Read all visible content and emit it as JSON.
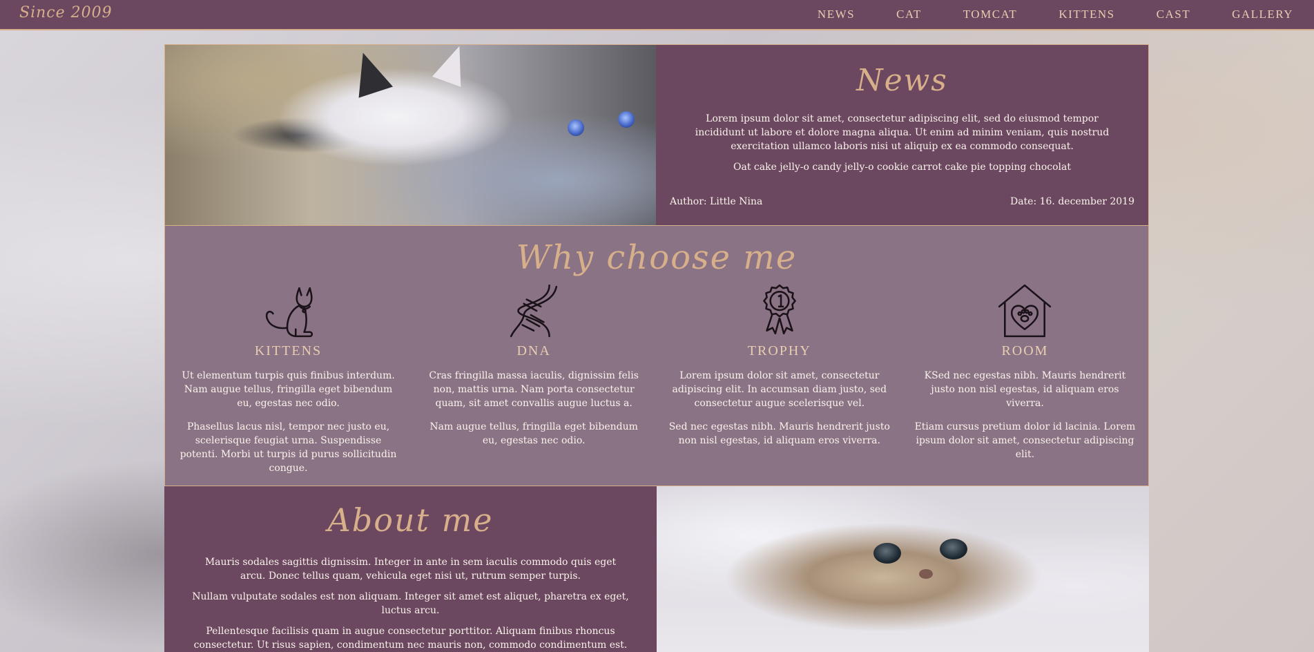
{
  "nav": {
    "brand": "Since 2009",
    "links": [
      "NEWS",
      "CAT",
      "TOMCAT",
      "KITTENS",
      "CAST",
      "GALLERY"
    ]
  },
  "news": {
    "title": "News",
    "text": "Lorem ipsum dolor sit amet, consectetur adipiscing elit, sed do eiusmod tempor incididunt ut labore et dolore magna aliqua. Ut enim ad minim veniam, quis nostrud exercitation ullamco laboris nisi ut aliquip ex ea commodo consequat.",
    "text2": "Oat cake jelly-o candy jelly-o cookie carrot cake pie topping chocolat",
    "author": "Author: Little Nina",
    "date": "Date: 16. december 2019"
  },
  "why": {
    "title": "Why choose me",
    "features": [
      {
        "icon": "cat-icon",
        "name": "KITTENS",
        "p1": "Ut elementum turpis quis finibus interdum. Nam augue tellus, fringilla eget bibendum eu, egestas nec odio.",
        "p2": "Phasellus lacus nisl, tempor nec justo eu, scelerisque feugiat urna. Suspendisse potenti. Morbi ut turpis id purus sollicitudin congue."
      },
      {
        "icon": "dna-icon",
        "name": "DNA",
        "p1": "Cras fringilla massa iaculis, dignissim felis non, mattis urna. Nam porta consectetur quam, sit amet convallis augue luctus a.",
        "p2": "Nam augue tellus, fringilla eget bibendum eu, egestas nec odio."
      },
      {
        "icon": "trophy-medal-icon",
        "name": "TROPHY",
        "p1": "Lorem ipsum dolor sit amet, consectetur adipiscing elit. In accumsan diam justo, sed consectetur augue scelerisque vel.",
        "p2": "Sed nec egestas nibh. Mauris hendrerit justo non nisl egestas, id aliquam eros viverra."
      },
      {
        "icon": "pet-house-icon",
        "name": "ROOM",
        "p1": "KSed nec egestas nibh. Mauris hendrerit justo non nisl egestas, id aliquam eros viverra.",
        "p2": "Etiam cursus pretium dolor id lacinia. Lorem ipsum dolor sit amet, consectetur adipiscing elit."
      }
    ]
  },
  "about": {
    "title": "About me",
    "paragraphs": [
      "Mauris sodales sagittis dignissim. Integer in ante in sem iaculis commodo quis eget arcu. Donec tellus quam, vehicula eget nisi ut, rutrum semper turpis.",
      "Nullam vulputate sodales est non aliquam. Integer sit amet est aliquet, pharetra ex eget, luctus arcu.",
      "Pellentesque facilisis quam in augue consectetur porttitor. Aliquam finibus rhoncus consectetur. Ut risus sapien, condimentum nec mauris non, commodo condimentum est."
    ]
  }
}
